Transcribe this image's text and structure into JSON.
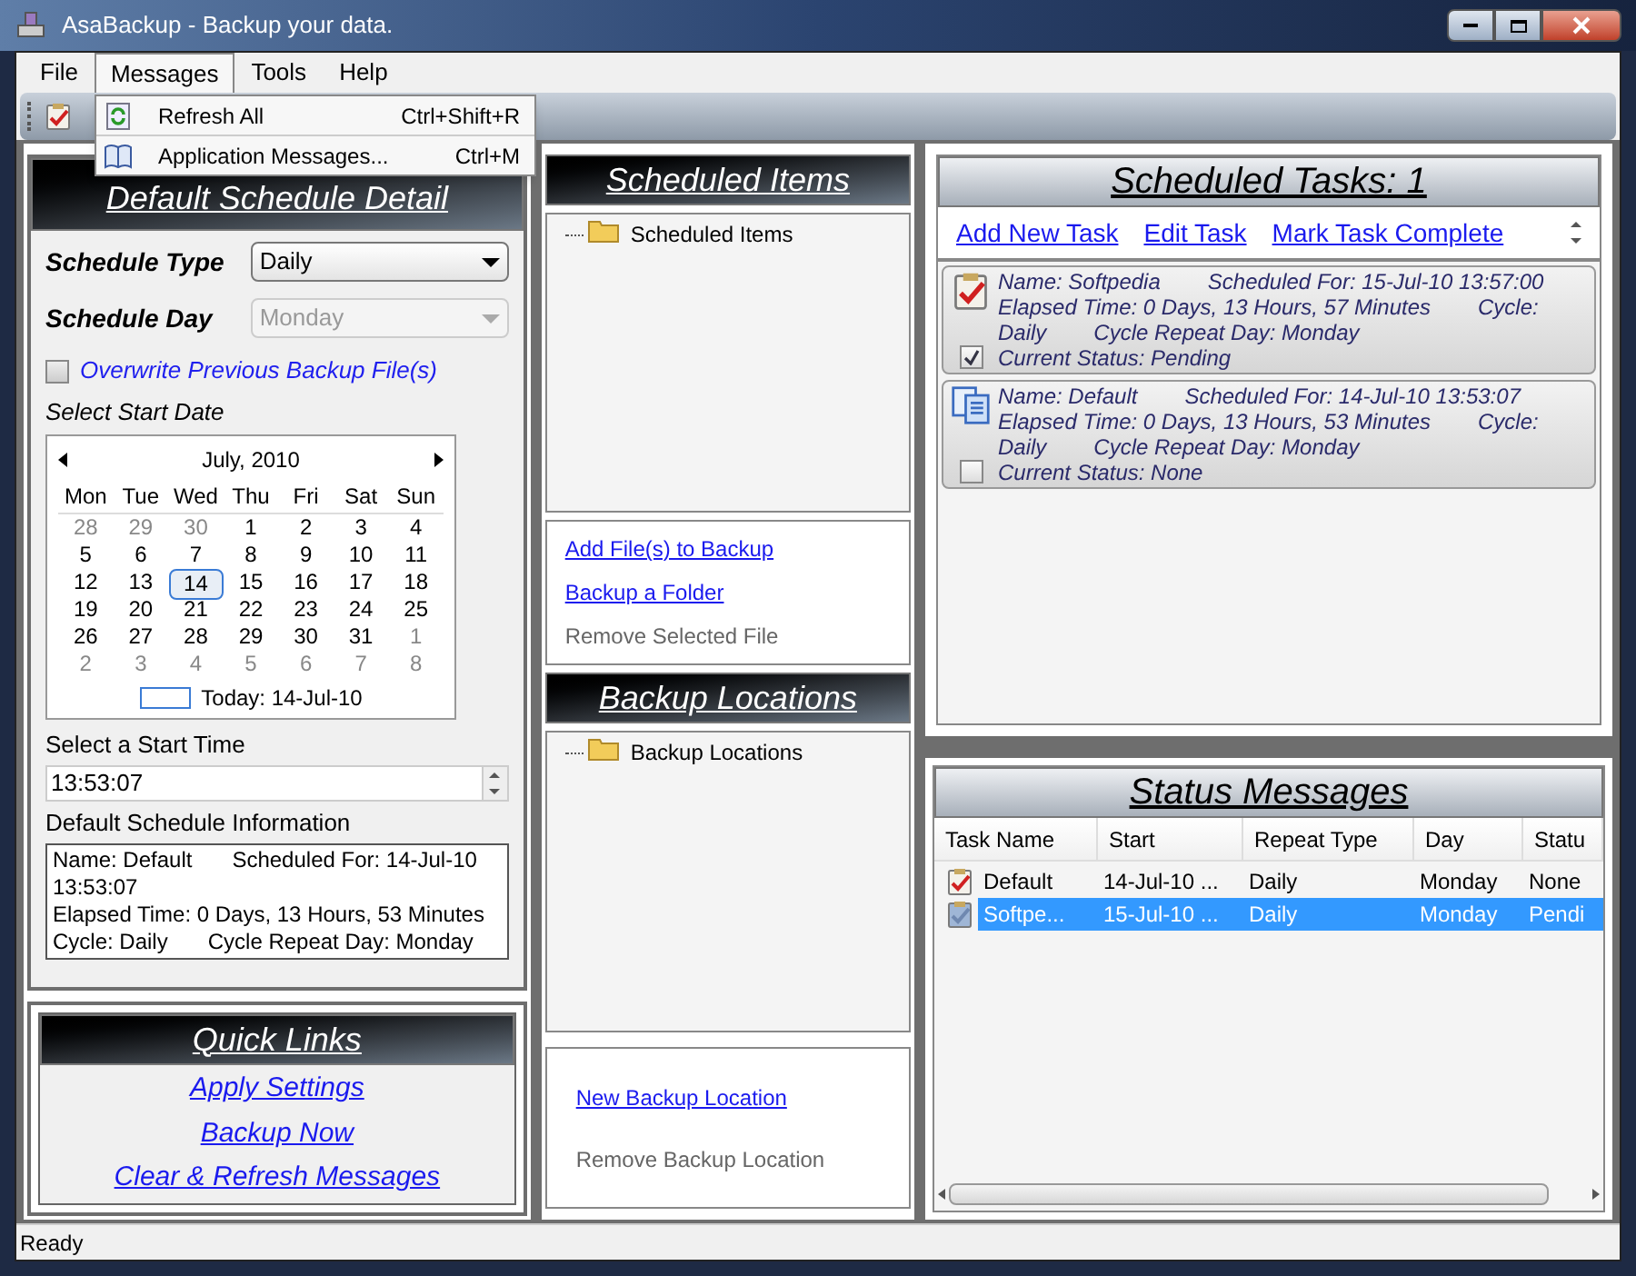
{
  "window": {
    "title": "AsaBackup - Backup your data."
  },
  "menu": [
    {
      "label": "File",
      "selected": false
    },
    {
      "label": "Messages",
      "selected": true
    },
    {
      "label": "Tools",
      "selected": false
    },
    {
      "label": "Help",
      "selected": false
    }
  ],
  "dropdown": [
    {
      "label": "Refresh All",
      "shortcut": "Ctrl+Shift+R",
      "kind": "refresh"
    },
    {
      "label": "Application Messages...",
      "shortcut": "Ctrl+M",
      "kind": "book"
    }
  ],
  "schedule_detail": {
    "title": "Default Schedule Detail",
    "type_label": "Schedule Type",
    "type_value": "Daily",
    "type_disabled": false,
    "day_label": "Schedule Day",
    "day_value": "Monday",
    "day_disabled": true,
    "overwrite": {
      "label": "Overwrite Previous Backup File(s)",
      "checked": false
    },
    "start_date_label": "Select Start Date",
    "calendar": {
      "month": "July, 2010",
      "weekdays": [
        "Mon",
        "Tue",
        "Wed",
        "Thu",
        "Fri",
        "Sat",
        "Sun"
      ],
      "weeks": [
        [
          {
            "day": "28",
            "muted": true,
            "selected": false
          },
          {
            "day": "29",
            "muted": true,
            "selected": false
          },
          {
            "day": "30",
            "muted": true,
            "selected": false
          },
          {
            "day": "1",
            "muted": false,
            "selected": false
          },
          {
            "day": "2",
            "muted": false,
            "selected": false
          },
          {
            "day": "3",
            "muted": false,
            "selected": false
          },
          {
            "day": "4",
            "muted": false,
            "selected": false
          }
        ],
        [
          {
            "day": "5",
            "muted": false,
            "selected": false
          },
          {
            "day": "6",
            "muted": false,
            "selected": false
          },
          {
            "day": "7",
            "muted": false,
            "selected": false
          },
          {
            "day": "8",
            "muted": false,
            "selected": false
          },
          {
            "day": "9",
            "muted": false,
            "selected": false
          },
          {
            "day": "10",
            "muted": false,
            "selected": false
          },
          {
            "day": "11",
            "muted": false,
            "selected": false
          }
        ],
        [
          {
            "day": "12",
            "muted": false,
            "selected": false
          },
          {
            "day": "13",
            "muted": false,
            "selected": false
          },
          {
            "day": "14",
            "muted": false,
            "selected": true
          },
          {
            "day": "15",
            "muted": false,
            "selected": false
          },
          {
            "day": "16",
            "muted": false,
            "selected": false
          },
          {
            "day": "17",
            "muted": false,
            "selected": false
          },
          {
            "day": "18",
            "muted": false,
            "selected": false
          }
        ],
        [
          {
            "day": "19",
            "muted": false,
            "selected": false
          },
          {
            "day": "20",
            "muted": false,
            "selected": false
          },
          {
            "day": "21",
            "muted": false,
            "selected": false
          },
          {
            "day": "22",
            "muted": false,
            "selected": false
          },
          {
            "day": "23",
            "muted": false,
            "selected": false
          },
          {
            "day": "24",
            "muted": false,
            "selected": false
          },
          {
            "day": "25",
            "muted": false,
            "selected": false
          }
        ],
        [
          {
            "day": "26",
            "muted": false,
            "selected": false
          },
          {
            "day": "27",
            "muted": false,
            "selected": false
          },
          {
            "day": "28",
            "muted": false,
            "selected": false
          },
          {
            "day": "29",
            "muted": false,
            "selected": false
          },
          {
            "day": "30",
            "muted": false,
            "selected": false
          },
          {
            "day": "31",
            "muted": false,
            "selected": false
          },
          {
            "day": "1",
            "muted": true,
            "selected": false
          }
        ],
        [
          {
            "day": "2",
            "muted": true,
            "selected": false
          },
          {
            "day": "3",
            "muted": true,
            "selected": false
          },
          {
            "day": "4",
            "muted": true,
            "selected": false
          },
          {
            "day": "5",
            "muted": true,
            "selected": false
          },
          {
            "day": "6",
            "muted": true,
            "selected": false
          },
          {
            "day": "7",
            "muted": true,
            "selected": false
          },
          {
            "day": "8",
            "muted": true,
            "selected": false
          }
        ]
      ],
      "today": "Today: 14-Jul-10"
    },
    "start_time_label": "Select a Start Time",
    "start_time": "13:53:07",
    "info_label": "Default Schedule Information",
    "info_lines": [
      [
        "Name: Default",
        "Scheduled For: 14-Jul-10"
      ],
      [
        "13:53:07"
      ],
      [
        "Elapsed Time: 0 Days, 13 Hours, 53 Minutes"
      ],
      [
        "Cycle: Daily",
        "Cycle Repeat Day: Monday"
      ]
    ]
  },
  "quick_links": {
    "title": "Quick Links",
    "links": [
      "Apply Settings",
      "Backup Now",
      "Clear & Refresh Messages"
    ]
  },
  "scheduled_items": {
    "title": "Scheduled Items",
    "tree_root": "Scheduled Items",
    "actions": [
      {
        "label": "Add File(s) to Backup",
        "disabled": false
      },
      {
        "label": "Backup a Folder",
        "disabled": false
      },
      {
        "label": "Remove Selected File",
        "disabled": true
      }
    ]
  },
  "backup_locations": {
    "title": "Backup Locations",
    "tree_root": "Backup Locations",
    "actions": [
      {
        "label": "New Backup Location",
        "disabled": false
      },
      {
        "label": "Remove Backup Location",
        "disabled": true
      }
    ]
  },
  "scheduled_tasks": {
    "title": "Scheduled Tasks: 1",
    "links": [
      "Add New Task",
      "Edit Task",
      "Mark Task Complete"
    ],
    "tasks": [
      {
        "checked": true,
        "kind": "clipboard",
        "lines": [
          [
            "Name: Softpedia",
            "Scheduled For: 15-Jul-10 13:57:00"
          ],
          [
            "Elapsed Time: 0 Days, 13 Hours, 57 Minutes",
            "Cycle:"
          ],
          [
            "Daily",
            "Cycle Repeat Day: Monday"
          ],
          [
            "Current Status: Pending"
          ]
        ]
      },
      {
        "checked": false,
        "kind": "documents",
        "lines": [
          [
            "Name: Default",
            "Scheduled For: 14-Jul-10 13:53:07"
          ],
          [
            "Elapsed Time: 0 Days, 13 Hours, 53 Minutes",
            "Cycle:"
          ],
          [
            "Daily",
            "Cycle Repeat Day: Monday"
          ],
          [
            "Current Status: None"
          ]
        ]
      }
    ]
  },
  "status_messages": {
    "title": "Status Messages",
    "columns": [
      "Task Name",
      "Start",
      "Repeat Type",
      "Day",
      "Statu"
    ],
    "rows": [
      {
        "selected": false,
        "cells": [
          "Default",
          "14-Jul-10 ...",
          "Daily",
          "Monday",
          "None"
        ]
      },
      {
        "selected": true,
        "cells": [
          "Softpe...",
          "15-Jul-10 ...",
          "Daily",
          "Monday",
          "Pendi"
        ]
      }
    ]
  },
  "status_bar": "Ready"
}
